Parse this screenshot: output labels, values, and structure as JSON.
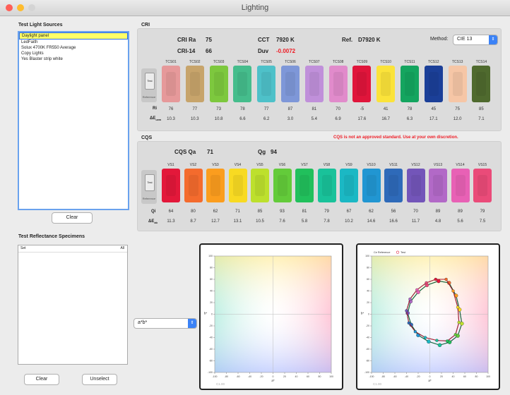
{
  "window": {
    "title": "Lighting"
  },
  "light_sources": {
    "title": "Test Light Sources",
    "items": [
      "Daylight panel",
      "LedFaith",
      "Solux 4700K FR550 Average",
      "Copy Lights",
      "Yes Blaster strip white"
    ],
    "selected_index": 0,
    "clear_label": "Clear"
  },
  "cri": {
    "title": "CRI",
    "ra_label": "CRI Ra",
    "ra_value": "75",
    "ri14_label": "CRI-14",
    "ri14_value": "66",
    "cct_label": "CCT",
    "cct_value": "7920 K",
    "duv_label": "Duv",
    "duv_value": "-0.0072",
    "ref_label": "Ref.",
    "ref_value": "D7920 K",
    "method_label": "Method:",
    "method_value": "CIE 13",
    "reference_label": "Reference",
    "test_label": "Test",
    "ri_label": "Ri",
    "de_label": "ΔE",
    "de_sub": "uvw",
    "samples": [
      {
        "name": "TCS01",
        "color": "#e6999a",
        "ri": "76",
        "de": "10.3"
      },
      {
        "name": "TCS02",
        "color": "#c7a46b",
        "ri": "77",
        "de": "10.3"
      },
      {
        "name": "TCS03",
        "color": "#7dc83e",
        "ri": "73",
        "de": "10.8"
      },
      {
        "name": "TCS04",
        "color": "#45bd8c",
        "ri": "78",
        "de": "6.6"
      },
      {
        "name": "TCS05",
        "color": "#4ec1c9",
        "ri": "77",
        "de": "6.2"
      },
      {
        "name": "TCS06",
        "color": "#7e97d8",
        "ri": "87",
        "de": "3.0"
      },
      {
        "name": "TCS07",
        "color": "#c090da",
        "ri": "81",
        "de": "5.4"
      },
      {
        "name": "TCS08",
        "color": "#e18bcb",
        "ri": "70",
        "de": "6.9"
      },
      {
        "name": "TCS09",
        "color": "#e0153b",
        "ri": "-5",
        "de": "17.6"
      },
      {
        "name": "TCS10",
        "color": "#fbe33a",
        "ri": "41",
        "de": "16.7"
      },
      {
        "name": "TCS11",
        "color": "#14a55f",
        "ri": "78",
        "de": "6.3"
      },
      {
        "name": "TCS12",
        "color": "#1b3f98",
        "ri": "45",
        "de": "17.1"
      },
      {
        "name": "TCS13",
        "color": "#f6c6a6",
        "ri": "75",
        "de": "12.0"
      },
      {
        "name": "TCS14",
        "color": "#4f6a2e",
        "ri": "85",
        "de": "7.1"
      }
    ]
  },
  "cqs": {
    "title": "CQS",
    "warning": "CQS is not an approved standard. Use at your own discretion.",
    "qa_label": "CQS Qa",
    "qa_value": "71",
    "qg_label": "Qg",
    "qg_value": "94",
    "reference_label": "Reference",
    "test_label": "Test",
    "qi_label": "Qi",
    "de_label": "ΔE",
    "de_sub": "ab",
    "samples": [
      {
        "name": "VS1",
        "color": "#e3183a",
        "qi": "64",
        "de": "11.3"
      },
      {
        "name": "VS2",
        "color": "#f46b2d",
        "qi": "80",
        "de": "8.7"
      },
      {
        "name": "VS3",
        "color": "#fb9d1e",
        "qi": "62",
        "de": "12.7"
      },
      {
        "name": "VS4",
        "color": "#f8da22",
        "qi": "71",
        "de": "13.1"
      },
      {
        "name": "VS5",
        "color": "#bde02d",
        "qi": "85",
        "de": "10.5"
      },
      {
        "name": "VS6",
        "color": "#63cb3a",
        "qi": "93",
        "de": "7.6"
      },
      {
        "name": "VS7",
        "color": "#21c05c",
        "qi": "81",
        "de": "5.8"
      },
      {
        "name": "VS8",
        "color": "#19c29a",
        "qi": "79",
        "de": "7.8"
      },
      {
        "name": "VS9",
        "color": "#1bb8c4",
        "qi": "67",
        "de": "10.2"
      },
      {
        "name": "VS10",
        "color": "#2196d2",
        "qi": "62",
        "de": "14.6"
      },
      {
        "name": "VS11",
        "color": "#2e6ab9",
        "qi": "56",
        "de": "16.6"
      },
      {
        "name": "VS12",
        "color": "#7355b9",
        "qi": "70",
        "de": "11.7"
      },
      {
        "name": "VS13",
        "color": "#b269c7",
        "qi": "89",
        "de": "4.8"
      },
      {
        "name": "VS14",
        "color": "#e861b5",
        "qi": "89",
        "de": "5.6"
      },
      {
        "name": "VS15",
        "color": "#ea4b79",
        "qi": "79",
        "de": "7.5"
      }
    ]
  },
  "specimens": {
    "title": "Test Reflectance Specimens",
    "header_left": "Set",
    "header_right": "All",
    "clear_label": "Clear",
    "unselect_label": "Unselect",
    "space_value": "a*b*"
  },
  "plots": {
    "axis_x": "a*",
    "axis_y": "b*",
    "ticks": [
      "-100",
      "-80",
      "-60",
      "-40",
      "-20",
      "0",
      "20",
      "40",
      "60",
      "80",
      "100"
    ],
    "corner_label": "C1.00",
    "legend_ref": "Ce Reference",
    "legend_test": "Test",
    "colors": {
      "reference": "#0a8a4a",
      "test": "#e01c3a",
      "outline": "#111111"
    }
  },
  "chart_data": [
    {
      "type": "scatter",
      "title": "",
      "xlabel": "a*",
      "ylabel": "b*",
      "xlim": [
        -100,
        100
      ],
      "ylim": [
        -100,
        100
      ],
      "grid": true,
      "series": []
    },
    {
      "type": "line",
      "title": "",
      "xlabel": "a*",
      "ylabel": "b*",
      "xlim": [
        -100,
        100
      ],
      "ylim": [
        -100,
        100
      ],
      "grid": true,
      "legend": "top-left",
      "series": [
        {
          "name": "Ce Reference",
          "points": [
            [
              15,
              57
            ],
            [
              33,
              54
            ],
            [
              45,
              32
            ],
            [
              51,
              8
            ],
            [
              55,
              -16
            ],
            [
              48,
              -37
            ],
            [
              34,
              -48
            ],
            [
              17,
              -53
            ],
            [
              -2,
              -47
            ],
            [
              -20,
              -36
            ],
            [
              -32,
              -18
            ],
            [
              -38,
              2
            ],
            [
              -33,
              22
            ],
            [
              -20,
              38
            ],
            [
              -5,
              50
            ]
          ]
        },
        {
          "name": "Test",
          "points": [
            [
              10,
              60
            ],
            [
              28,
              60
            ],
            [
              40,
              40
            ],
            [
              48,
              12
            ],
            [
              50,
              -14
            ],
            [
              44,
              -35
            ],
            [
              30,
              -46
            ],
            [
              12,
              -45
            ],
            [
              -8,
              -40
            ],
            [
              -25,
              -30
            ],
            [
              -36,
              -15
            ],
            [
              -40,
              6
            ],
            [
              -34,
              26
            ],
            [
              -22,
              42
            ],
            [
              -6,
              54
            ]
          ]
        }
      ]
    }
  ]
}
